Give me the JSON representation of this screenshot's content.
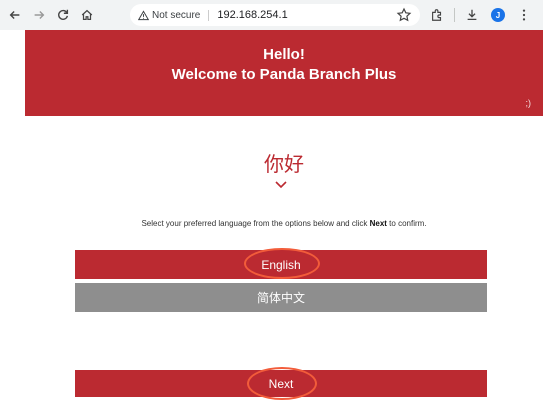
{
  "browser": {
    "security_label": "Not secure",
    "url": "192.168.254.1",
    "profile_initial": "J"
  },
  "header": {
    "title": "Hello!",
    "subtitle": "Welcome to Panda Branch Plus",
    "wink": ";)"
  },
  "main": {
    "greeting": "你好",
    "instructions_prefix": "Select your preferred language from the options below and click ",
    "instructions_bold": "Next",
    "instructions_suffix": " to confirm.",
    "languages": [
      {
        "label": "English",
        "selected": true
      },
      {
        "label": "简体中文",
        "selected": false
      }
    ],
    "next_label": "Next"
  },
  "colors": {
    "brand_red": "#bb2a31",
    "inactive_gray": "#8e8e8e",
    "annotation_orange": "#f25c3a"
  }
}
